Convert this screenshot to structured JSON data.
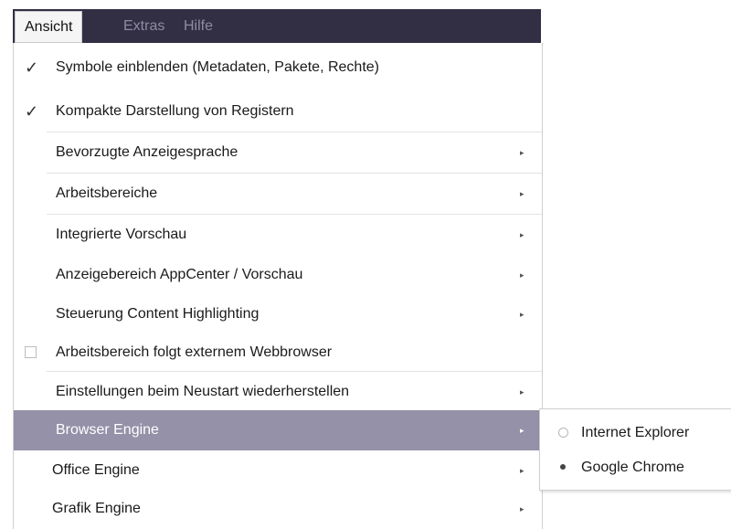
{
  "menubar": {
    "items": [
      {
        "label": "Ansicht"
      },
      {
        "label": "Extras"
      },
      {
        "label": "Hilfe"
      }
    ]
  },
  "dropdown": {
    "items": [
      {
        "label": "Symbole einblenden (Metadaten, Pakete, Rechte)",
        "checked": true
      },
      {
        "label": "Kompakte Darstellung von Registern",
        "checked": true
      },
      {
        "label": "Bevorzugte Anzeigesprache",
        "submenu": true
      },
      {
        "label": "Arbeitsbereiche",
        "submenu": true
      },
      {
        "label": "Integrierte Vorschau",
        "submenu": true
      },
      {
        "label": "Anzeigebereich AppCenter / Vorschau",
        "submenu": true
      },
      {
        "label": "Steuerung Content Highlighting",
        "submenu": true
      },
      {
        "label": "Arbeitsbereich folgt externem Webbrowser",
        "checkbox": true,
        "checked": false
      },
      {
        "label": "Einstellungen beim Neustart wiederherstellen",
        "submenu": true
      },
      {
        "label": "Browser Engine",
        "submenu": true,
        "highlighted": true
      },
      {
        "label": "Office Engine",
        "submenu": true
      },
      {
        "label": "Grafik Engine",
        "submenu": true
      }
    ],
    "check_glyph": "✓",
    "arrow_glyph": "▸"
  },
  "browser_engine_submenu": {
    "items": [
      {
        "label": "Internet Explorer",
        "selected": false
      },
      {
        "label": "Google Chrome",
        "selected": true
      }
    ]
  },
  "colors": {
    "menubar_bg": "#322f45",
    "highlight_bg": "#9491a8"
  }
}
